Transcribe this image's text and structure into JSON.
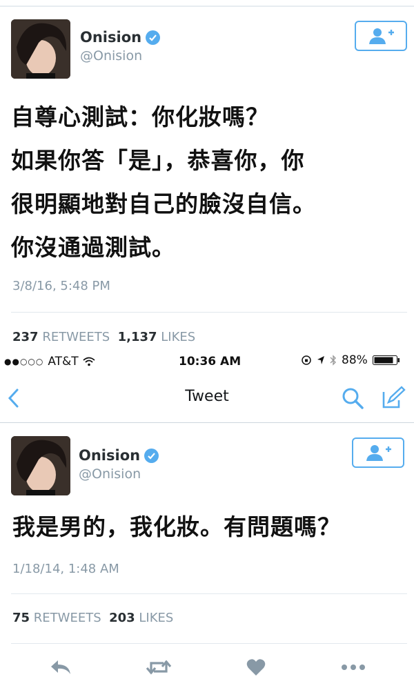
{
  "tweet1": {
    "display_name": "Onision",
    "handle": "@Onision",
    "text_lines": [
      "自尊心測試：你化妝嗎？",
      "如果你答「是」，恭喜你，你",
      "很明顯地對自己的臉沒自信。",
      "你沒通過測試。"
    ],
    "date": "3/8/16, 5:48 PM",
    "retweets_count": "237",
    "retweets_label": "RETWEETS",
    "likes_count": "1,137",
    "likes_label": "LIKES"
  },
  "statusbar": {
    "signal": "●●○○○",
    "carrier": "AT&T",
    "time": "10:36 AM",
    "battery": "88%"
  },
  "navbar": {
    "title": "Tweet"
  },
  "tweet2": {
    "display_name": "Onision",
    "handle": "@Onision",
    "text": "我是男的，我化妝。有問題嗎？",
    "date": "1/18/14, 1:48 AM",
    "retweets_count": "75",
    "retweets_label": "RETWEETS",
    "likes_count": "203",
    "likes_label": "LIKES"
  },
  "icons": {
    "verified": "verified-badge-icon",
    "follow": "add-user-icon",
    "back": "chevron-left-icon",
    "search": "search-icon",
    "compose": "compose-icon",
    "reply": "reply-icon",
    "retweet": "retweet-icon",
    "like": "heart-icon",
    "more": "more-dots-icon"
  },
  "colors": {
    "accent": "#55acee",
    "muted": "#8899a6"
  }
}
